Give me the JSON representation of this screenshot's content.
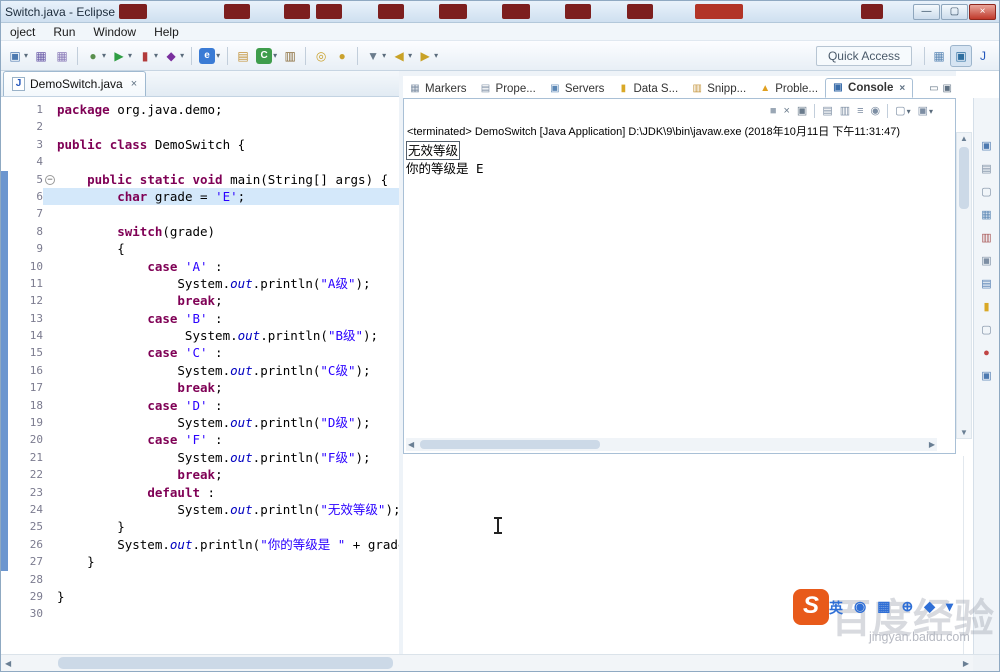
{
  "window": {
    "title": "Switch.java - Eclipse"
  },
  "menubar": {
    "items": [
      "oject",
      "Run",
      "Window",
      "Help"
    ]
  },
  "toolbar": {
    "quick_access": "Quick Access",
    "buttons": [
      {
        "name": "new-button",
        "icon": "new-wizard-icon",
        "glyph": "▣",
        "color": "#4d79b0",
        "caret": true
      },
      {
        "name": "save-button",
        "icon": "save-icon",
        "glyph": "▦",
        "color": "#6a5aa8"
      },
      {
        "name": "save-all-button",
        "icon": "save-all-icon",
        "glyph": "▦",
        "color": "#8a7ab8"
      },
      {
        "sep": true
      },
      {
        "name": "debug-button",
        "icon": "debug-icon",
        "glyph": "●",
        "color": "#5a8f4e",
        "caret": true
      },
      {
        "name": "run-button",
        "icon": "run-icon",
        "glyph": "▶",
        "color": "#2f9e44",
        "caret": true
      },
      {
        "name": "coverage-button",
        "icon": "coverage-icon",
        "glyph": "▮",
        "color": "#b23b3b",
        "caret": true
      },
      {
        "name": "external-tools-button",
        "icon": "external-tools-icon",
        "glyph": "◆",
        "color": "#7a2f9e",
        "caret": true
      },
      {
        "sep": true
      },
      {
        "name": "internal-browser-button",
        "icon": "browser-icon",
        "glyph": "e",
        "bg": "#3a7bd5",
        "caret": true
      },
      {
        "sep": true
      },
      {
        "name": "new-java-project-button",
        "icon": "java-project-icon",
        "glyph": "▤",
        "color": "#c29136"
      },
      {
        "name": "new-class-button",
        "icon": "new-class-icon",
        "glyph": "C",
        "bg": "#3f9d4c",
        "caret": true
      },
      {
        "name": "new-package-button",
        "icon": "new-package-icon",
        "glyph": "▥",
        "color": "#8a6d3b"
      },
      {
        "sep": true
      },
      {
        "name": "open-type-button",
        "icon": "open-type-icon",
        "glyph": "◎",
        "color": "#caa22e"
      },
      {
        "name": "search-button",
        "icon": "search-icon",
        "glyph": "●",
        "color": "#caa22e"
      },
      {
        "sep": true
      },
      {
        "name": "last-edit-location-button",
        "icon": "edit-location-icon",
        "glyph": "▼",
        "color": "#6a7b8c",
        "caret": true
      },
      {
        "name": "back-button",
        "icon": "back-arrow-icon",
        "glyph": "◀",
        "color": "#c9a227",
        "caret": true
      },
      {
        "name": "forward-button",
        "icon": "forward-arrow-icon",
        "glyph": "▶",
        "color": "#c9a227",
        "caret": true
      }
    ],
    "perspectives": [
      {
        "name": "open-perspective-button",
        "icon": "open-perspective-icon",
        "glyph": "▦",
        "color": "#5b87b5"
      },
      {
        "name": "javaee-perspective-button",
        "icon": "javaee-perspective-icon",
        "glyph": "▣",
        "color": "#2f6fa0",
        "active": true
      },
      {
        "name": "java-perspective-button",
        "icon": "java-perspective-icon",
        "glyph": "J",
        "color": "#2255bb"
      }
    ]
  },
  "editor": {
    "tab": {
      "label": "DemoSwitch.java",
      "icon_letter": "J"
    },
    "lines": [
      {
        "n": 1,
        "t": [
          [
            "k",
            "package"
          ],
          [
            "p",
            " org.java.demo;"
          ]
        ]
      },
      {
        "n": 2,
        "t": []
      },
      {
        "n": 3,
        "t": [
          [
            "k",
            "public"
          ],
          [
            "p",
            " "
          ],
          [
            "k",
            "class"
          ],
          [
            "p",
            " DemoSwitch {"
          ]
        ]
      },
      {
        "n": 4,
        "t": []
      },
      {
        "n": 5,
        "fold": true,
        "t": [
          [
            "p",
            "    "
          ],
          [
            "k",
            "public"
          ],
          [
            "p",
            " "
          ],
          [
            "k",
            "static"
          ],
          [
            "p",
            " "
          ],
          [
            "k",
            "void"
          ],
          [
            "p",
            " main(String[] args) {"
          ]
        ]
      },
      {
        "n": 6,
        "current": true,
        "t": [
          [
            "p",
            "        "
          ],
          [
            "k",
            "char"
          ],
          [
            "p",
            " grade = "
          ],
          [
            "s",
            "'E'"
          ],
          [
            "p",
            ";"
          ]
        ]
      },
      {
        "n": 7,
        "t": []
      },
      {
        "n": 8,
        "t": [
          [
            "p",
            "        "
          ],
          [
            "k",
            "switch"
          ],
          [
            "p",
            "(grade)"
          ]
        ]
      },
      {
        "n": 9,
        "t": [
          [
            "p",
            "        {"
          ]
        ]
      },
      {
        "n": 10,
        "t": [
          [
            "p",
            "            "
          ],
          [
            "k",
            "case"
          ],
          [
            "p",
            " "
          ],
          [
            "s",
            "'A'"
          ],
          [
            "p",
            " :"
          ]
        ]
      },
      {
        "n": 11,
        "t": [
          [
            "p",
            "                System."
          ],
          [
            "f",
            "out"
          ],
          [
            "p",
            ".println("
          ],
          [
            "s",
            "\"A级\""
          ],
          [
            "p",
            ");"
          ]
        ]
      },
      {
        "n": 12,
        "t": [
          [
            "p",
            "                "
          ],
          [
            "k",
            "break"
          ],
          [
            "p",
            ";"
          ]
        ]
      },
      {
        "n": 13,
        "t": [
          [
            "p",
            "            "
          ],
          [
            "k",
            "case"
          ],
          [
            "p",
            " "
          ],
          [
            "s",
            "'B'"
          ],
          [
            "p",
            " :"
          ]
        ]
      },
      {
        "n": 14,
        "t": [
          [
            "p",
            "                 System."
          ],
          [
            "f",
            "out"
          ],
          [
            "p",
            ".println("
          ],
          [
            "s",
            "\"B级\""
          ],
          [
            "p",
            ");"
          ]
        ]
      },
      {
        "n": 15,
        "t": [
          [
            "p",
            "            "
          ],
          [
            "k",
            "case"
          ],
          [
            "p",
            " "
          ],
          [
            "s",
            "'C'"
          ],
          [
            "p",
            " :"
          ]
        ]
      },
      {
        "n": 16,
        "t": [
          [
            "p",
            "                System."
          ],
          [
            "f",
            "out"
          ],
          [
            "p",
            ".println("
          ],
          [
            "s",
            "\"C级\""
          ],
          [
            "p",
            ");"
          ]
        ]
      },
      {
        "n": 17,
        "t": [
          [
            "p",
            "                "
          ],
          [
            "k",
            "break"
          ],
          [
            "p",
            ";"
          ]
        ]
      },
      {
        "n": 18,
        "t": [
          [
            "p",
            "            "
          ],
          [
            "k",
            "case"
          ],
          [
            "p",
            " "
          ],
          [
            "s",
            "'D'"
          ],
          [
            "p",
            " :"
          ]
        ]
      },
      {
        "n": 19,
        "t": [
          [
            "p",
            "                System."
          ],
          [
            "f",
            "out"
          ],
          [
            "p",
            ".println("
          ],
          [
            "s",
            "\"D级\""
          ],
          [
            "p",
            ");"
          ]
        ]
      },
      {
        "n": 20,
        "t": [
          [
            "p",
            "            "
          ],
          [
            "k",
            "case"
          ],
          [
            "p",
            " "
          ],
          [
            "s",
            "'F'"
          ],
          [
            "p",
            " :"
          ]
        ]
      },
      {
        "n": 21,
        "t": [
          [
            "p",
            "                System."
          ],
          [
            "f",
            "out"
          ],
          [
            "p",
            ".println("
          ],
          [
            "s",
            "\"F级\""
          ],
          [
            "p",
            ");"
          ]
        ]
      },
      {
        "n": 22,
        "t": [
          [
            "p",
            "                "
          ],
          [
            "k",
            "break"
          ],
          [
            "p",
            ";"
          ]
        ]
      },
      {
        "n": 23,
        "t": [
          [
            "p",
            "            "
          ],
          [
            "k",
            "default"
          ],
          [
            "p",
            " :"
          ]
        ]
      },
      {
        "n": 24,
        "t": [
          [
            "p",
            "                System."
          ],
          [
            "f",
            "out"
          ],
          [
            "p",
            ".println("
          ],
          [
            "s",
            "\"无效等级\""
          ],
          [
            "p",
            ");"
          ]
        ]
      },
      {
        "n": 25,
        "t": [
          [
            "p",
            "        }"
          ]
        ]
      },
      {
        "n": 26,
        "t": [
          [
            "p",
            "        System."
          ],
          [
            "f",
            "out"
          ],
          [
            "p",
            ".println("
          ],
          [
            "s",
            "\"你的等级是 \""
          ],
          [
            "p",
            " + grade);"
          ]
        ]
      },
      {
        "n": 27,
        "t": [
          [
            "p",
            "    }"
          ]
        ]
      },
      {
        "n": 28,
        "t": []
      },
      {
        "n": 29,
        "t": [
          [
            "p",
            "}"
          ]
        ]
      },
      {
        "n": 30,
        "t": []
      }
    ]
  },
  "console": {
    "tabs": [
      {
        "name": "tab-markers",
        "label": "Markers",
        "icon": "markers-icon",
        "glyph": "▦",
        "color": "#7d8ea3"
      },
      {
        "name": "tab-properties",
        "label": "Prope...",
        "icon": "properties-icon",
        "glyph": "▤",
        "color": "#7d8ea3"
      },
      {
        "name": "tab-servers",
        "label": "Servers",
        "icon": "servers-icon",
        "glyph": "▣",
        "color": "#5b87b5"
      },
      {
        "name": "tab-data-source",
        "label": "Data S...",
        "icon": "data-source-icon",
        "glyph": "▮",
        "color": "#d9a826"
      },
      {
        "name": "tab-snippets",
        "label": "Snipp...",
        "icon": "snippets-icon",
        "glyph": "▥",
        "color": "#c29136"
      },
      {
        "name": "tab-problems",
        "label": "Proble...",
        "icon": "problems-icon",
        "glyph": "▲",
        "color": "#e0a020"
      },
      {
        "name": "tab-console",
        "label": "Console",
        "icon": "console-icon",
        "glyph": "▣",
        "color": "#3a6daa",
        "active": true,
        "closable": true
      }
    ],
    "toolbar": [
      {
        "name": "terminate-button",
        "glyph": "■",
        "color": "#9aa7b5"
      },
      {
        "name": "remove-launch-button",
        "glyph": "×",
        "color": "#6a7b8c"
      },
      {
        "name": "remove-all-launches-button",
        "glyph": "▣",
        "color": "#6a7b8c"
      },
      {
        "sep": true
      },
      {
        "name": "clear-console-button",
        "glyph": "▤",
        "color": "#7d8ea3"
      },
      {
        "name": "scroll-lock-button",
        "glyph": "▥",
        "color": "#7d8ea3"
      },
      {
        "name": "word-wrap-button",
        "glyph": "≡",
        "color": "#7d8ea3"
      },
      {
        "name": "pin-console-button",
        "glyph": "◉",
        "color": "#7d8ea3"
      },
      {
        "sep": true
      },
      {
        "name": "display-console-button",
        "glyph": "▢",
        "color": "#7d8ea3",
        "caret": true
      },
      {
        "name": "open-console-button",
        "glyph": "▣",
        "color": "#7d8ea3",
        "caret": true
      }
    ],
    "header": "<terminated> DemoSwitch [Java Application] D:\\JDK\\9\\bin\\javaw.exe (2018年10月11日 下午11:31:47)",
    "output": [
      "无效等级",
      "你的等级是 E"
    ]
  },
  "right_strip": [
    {
      "name": "restore-view-icon",
      "glyph": "▣",
      "color": "#4d79b0"
    },
    {
      "name": "minimized-view-icon-1",
      "glyph": "▤",
      "color": "#7d8ea3"
    },
    {
      "name": "minimized-view-icon-2",
      "glyph": "▢",
      "color": "#7d8ea3"
    },
    {
      "name": "minimized-view-icon-3",
      "glyph": "▦",
      "color": "#5b87b5"
    },
    {
      "name": "minimized-view-icon-4",
      "glyph": "▥",
      "color": "#a85454"
    },
    {
      "name": "minimized-view-icon-5",
      "glyph": "▣",
      "color": "#7d8ea3"
    },
    {
      "name": "minimized-view-icon-6",
      "glyph": "▤",
      "color": "#4d79b0"
    },
    {
      "name": "minimized-data-source-icon",
      "glyph": "▮",
      "color": "#d9a826"
    },
    {
      "name": "minimized-view-icon-7",
      "glyph": "▢",
      "color": "#7d8ea3"
    },
    {
      "name": "minimized-view-icon-8",
      "glyph": "●",
      "color": "#c04545"
    },
    {
      "name": "minimized-view-icon-9",
      "glyph": "▣",
      "color": "#4d79b0"
    }
  ],
  "language_bar": [
    {
      "name": "input-language-icon",
      "glyph": "英"
    },
    {
      "name": "hand-tool-icon",
      "glyph": "◉"
    },
    {
      "name": "keyboard-layout-icon",
      "glyph": "▦"
    },
    {
      "name": "ime-settings-icon",
      "glyph": "⊕"
    },
    {
      "name": "tool-icon",
      "glyph": "◆"
    },
    {
      "name": "options-caret-icon",
      "glyph": "▾"
    }
  ],
  "watermark": {
    "logo_letter": "S",
    "ghost_text": "百度经验",
    "url": "jingyan.baidu.com"
  },
  "icons": {
    "close": "×",
    "caret": "▾",
    "minimize": "▭",
    "maximize": "▣",
    "win_minimize": "—",
    "win_maximize": "▢",
    "win_close": "×",
    "scroll_up": "▲",
    "scroll_down": "▼",
    "scroll_left": "◀",
    "scroll_right": "▶",
    "fold_minus": "−"
  }
}
